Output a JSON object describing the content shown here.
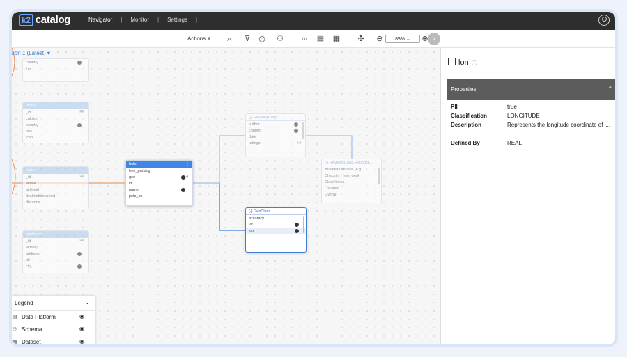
{
  "app": {
    "logo_mark": "k2",
    "logo_text": "catalog"
  },
  "nav": {
    "items": [
      "Navigator",
      "Monitor",
      "Settings"
    ],
    "active": "Navigator"
  },
  "toolbar": {
    "actions_label": "Actions",
    "zoom": "83%"
  },
  "canvas": {
    "version_label": "sion 1 (Latest)"
  },
  "cards": {
    "top_left": {
      "rows": [
        "country",
        "live"
      ]
    },
    "mid_left": {
      "title": "visitor",
      "rows": [
        {
          "name": "_id",
          "tag": "PK"
        },
        {
          "name": "callsign",
          "tag": ""
        },
        {
          "name": "country",
          "tag": ""
        },
        {
          "name": "iata",
          "tag": ""
        },
        {
          "name": "icao",
          "tag": ""
        }
      ]
    },
    "route": {
      "title": "route",
      "rows": [
        {
          "name": "_id",
          "tag": "PK"
        },
        {
          "name": "airline",
          "tag": ""
        },
        {
          "name": "airlineid",
          "tag": ""
        },
        {
          "name": "destinationairport",
          "tag": ""
        },
        {
          "name": "distance",
          "tag": ""
        }
      ]
    },
    "landmark": {
      "title": "landmark",
      "rows": [
        {
          "name": "_id",
          "tag": "PK"
        },
        {
          "name": "activity",
          "tag": ""
        },
        {
          "name": "address",
          "tag": ""
        },
        {
          "name": "alt",
          "tag": ""
        },
        {
          "name": "city",
          "tag": ""
        }
      ]
    },
    "hotel": {
      "title": "hotel",
      "rows": [
        "free_parking",
        "geo",
        "id",
        "name",
        "pets_ok"
      ]
    },
    "reviews": {
      "title": "{-} ReviewsClass",
      "rows": [
        "author",
        "content",
        "date",
        "ratings"
      ]
    },
    "geo": {
      "title": "{-} GeoClass",
      "rows": [
        "accuracy",
        "lat",
        "lon"
      ]
    },
    "ratings": {
      "title": "{-} ReviewsClass.RatingsC...",
      "rows": [
        "Business service (e.g....",
        "Check in / front desk",
        "Cleanliness",
        "Location",
        "Overall"
      ]
    }
  },
  "legend": {
    "title": "Legend",
    "items": [
      "Data Platform",
      "Schema",
      "Dataset"
    ]
  },
  "side_panel": {
    "title": "lon",
    "section": "Properties",
    "properties": [
      {
        "key": "PII",
        "value": "true"
      },
      {
        "key": "Classification",
        "value": "LONGITUDE"
      },
      {
        "key": "Description",
        "value": "Represents the longitude coordinate of l..."
      }
    ],
    "defined_by": {
      "key": "Defined By",
      "value": "REAL"
    }
  },
  "colors": {
    "accent": "#3f86e6",
    "topbar": "#2e2e2e",
    "link": "#5b8fd8",
    "orange": "#e8894a"
  }
}
